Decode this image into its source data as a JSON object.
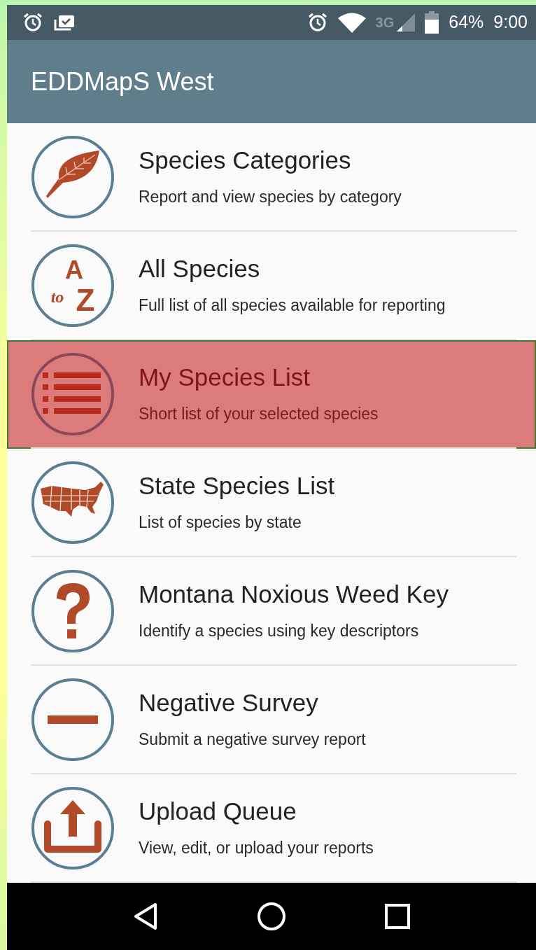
{
  "status_bar": {
    "network": "3G",
    "battery": "64%",
    "time": "9:00"
  },
  "app_bar": {
    "title": "EDDMapS West"
  },
  "menu": [
    {
      "kind": "leaf",
      "title": "Species Categories",
      "subtitle": "Report and view species by category",
      "selected": false
    },
    {
      "kind": "atoz",
      "icon_letters": [
        "A",
        "to",
        "Z"
      ],
      "title": "All Species",
      "subtitle": "Full list of all species available for reporting",
      "selected": false
    },
    {
      "kind": "list",
      "title": "My Species List",
      "subtitle": "Short list of your selected species",
      "selected": true
    },
    {
      "kind": "map",
      "title": "State Species List",
      "subtitle": "List of species by state",
      "selected": false
    },
    {
      "kind": "question",
      "title": "Montana Noxious Weed Key",
      "subtitle": "Identify a species using key descriptors",
      "selected": false
    },
    {
      "kind": "minus",
      "title": "Negative Survey",
      "subtitle": "Submit a negative survey report",
      "selected": false
    },
    {
      "kind": "upload",
      "title": "Upload Queue",
      "subtitle": "View, edit, or upload your reports",
      "selected": false
    }
  ]
}
